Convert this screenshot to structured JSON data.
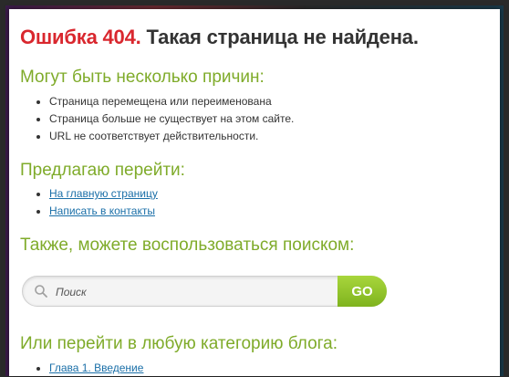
{
  "header": {
    "error_code": "Ошибка 404.",
    "error_message": "Такая страница не найдена."
  },
  "reasons": {
    "heading": "Могут быть несколько причин:",
    "items": [
      "Страница перемещена или переименована",
      "Страница больше не существует на этом сайте.",
      "URL не соответствует действительности."
    ]
  },
  "suggest": {
    "heading": "Предлагаю перейти:",
    "links": [
      "На главную страницу",
      "Написать в контакты"
    ]
  },
  "search": {
    "heading": "Также, можете воспользоваться поиском:",
    "placeholder": "Поиск",
    "button_label": "GO"
  },
  "categories": {
    "heading": "Или перейти в любую категорию блога:",
    "links": [
      "Глава 1. Введение"
    ]
  },
  "colors": {
    "error_red": "#d9272e",
    "heading_green": "#7fab2a",
    "link_blue": "#1a6fa8",
    "go_green": "#8cc12a"
  }
}
